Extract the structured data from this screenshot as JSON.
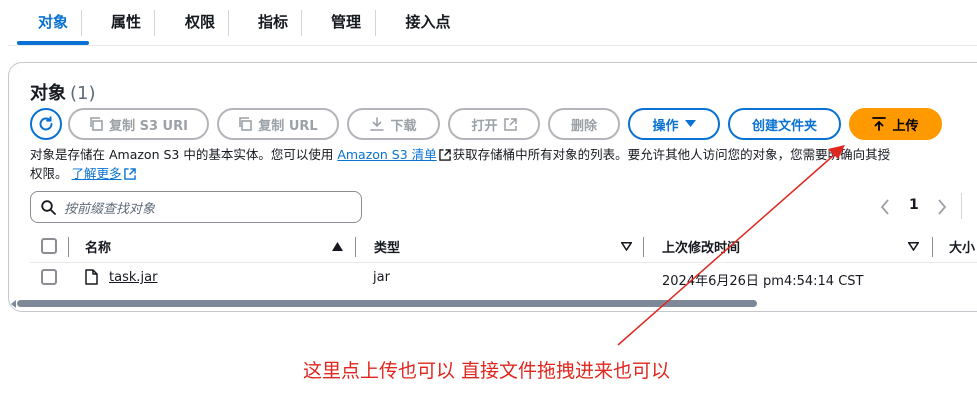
{
  "tabs": [
    "对象",
    "属性",
    "权限",
    "指标",
    "管理",
    "接入点"
  ],
  "panel": {
    "title": "对象",
    "count": "(1)"
  },
  "toolbar": {
    "copy_s3_uri": "复制 S3 URI",
    "copy_url": "复制 URL",
    "download": "下载",
    "open": "打开",
    "delete": "删除",
    "actions": "操作",
    "create_folder": "创建文件夹",
    "upload": "上传"
  },
  "description": {
    "part1": "对象是存储在 Amazon S3 中的基本实体。您可以使用 ",
    "link_inventory": "Amazon S3 清单",
    "part2": "获取存储桶中所有对象的列表。要允许其他人访问您的对象，您需要明确向其授",
    "part3": "权限。",
    "link_learn": "了解更多"
  },
  "search": {
    "placeholder": "按前缀查找对象"
  },
  "pagination": {
    "page": "1"
  },
  "table": {
    "headers": {
      "name": "名称",
      "type": "类型",
      "last_modified": "上次修改时间",
      "size": "大小"
    },
    "rows": [
      {
        "name": "task.jar",
        "type": "jar",
        "last_modified": "2024年6月26日 pm4:54:14 CST"
      }
    ]
  },
  "annotation": {
    "text": "这里点上传也可以 直接文件拖拽进来也可以",
    "color": "#e0271f"
  },
  "colors": {
    "accent": "#0972d3",
    "primary": "#ff9900"
  }
}
